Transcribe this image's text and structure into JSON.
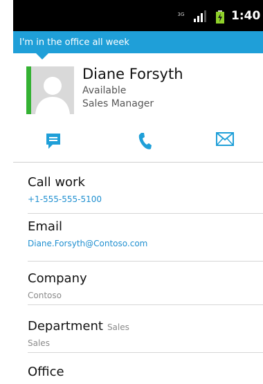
{
  "status_bar": {
    "network_type": "3G",
    "time": "1:40"
  },
  "presence_note": "I'm in the office all week",
  "contact": {
    "name": "Diane Forsyth",
    "status": "Available",
    "title": "Sales Manager"
  },
  "actions": {
    "icons": [
      "message-icon",
      "phone-icon",
      "email-icon"
    ]
  },
  "details": {
    "call_work": {
      "label": "Call work",
      "value": "+1-555-555-5100"
    },
    "email": {
      "label": "Email",
      "value": "Diane.Forsyth@Contoso.com"
    },
    "company": {
      "label": "Company",
      "value": "Contoso"
    },
    "department": {
      "label": "Department",
      "inline_value": "Sales",
      "value": "Sales"
    },
    "office": {
      "label": "Office"
    }
  },
  "colors": {
    "accent": "#1f9fd8",
    "presence_available": "#34b233",
    "link": "#1f8fd0"
  }
}
